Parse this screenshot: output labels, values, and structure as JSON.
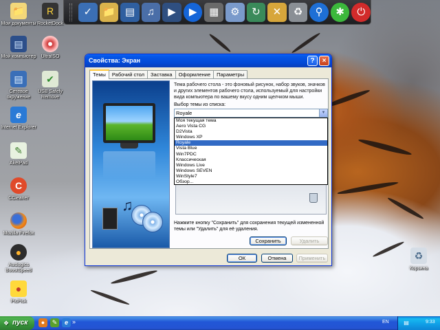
{
  "desktop": {
    "icons": [
      {
        "label": "Мои документы",
        "icon": "folder-icon"
      },
      {
        "label": "RocketDock",
        "icon": "rocket-icon"
      },
      {
        "label": "Мой компьютер",
        "icon": "computer-icon"
      },
      {
        "label": "UltraISO",
        "icon": "disc-icon"
      },
      {
        "label": "Сетевое окружение",
        "icon": "network-icon"
      },
      {
        "label": "USB Safely Remove",
        "icon": "usb-icon"
      },
      {
        "label": "Internet Explorer",
        "icon": "ie-icon"
      },
      {
        "label": "AkelPad",
        "icon": "notepad-icon"
      },
      {
        "label": "CCleaner",
        "icon": "ccleaner-icon"
      },
      {
        "label": "Mozilla Firefox",
        "icon": "firefox-icon"
      },
      {
        "label": "Auslogics BoostSpeed",
        "icon": "boostspeed-icon"
      },
      {
        "label": "PicPick",
        "icon": "picpick-icon"
      },
      {
        "label": "Корзина",
        "icon": "recycle-bin-icon"
      }
    ]
  },
  "quicklaunch": {
    "icons": [
      "monitor-check-icon",
      "folder-icon",
      "document-icon",
      "music-icon",
      "video-icon",
      "play-icon",
      "calculator-icon",
      "settings-icon",
      "network-refresh-icon",
      "close-box-icon",
      "cleanup-icon",
      "search-icon",
      "help-icon",
      "power-icon"
    ]
  },
  "dialog": {
    "title": "Свойства: Экран",
    "help_btn": "?",
    "close_btn": "×",
    "tabs": [
      "Темы",
      "Рабочий стол",
      "Заставка",
      "Оформление",
      "Параметры"
    ],
    "description": "Тема рабочего стола - это фоновый рисунок, набор звуков, значков и других элементов рабочего стола, используемый для настройки вида компьютера по вашему вкусу одним щелчком мыши.",
    "choose_label": "Выбор темы из списка:",
    "selected_theme": "Royale",
    "theme_options": [
      "Моя текущая тема",
      "Aero Vista CG",
      "D2Vista",
      "Windows XP",
      "Royale",
      "Vista Blue",
      "Win7PDC",
      "Классическая",
      "Windows Live",
      "Windows SEVEN",
      "WinStyle7",
      "Обзор..."
    ],
    "selected_index": 4,
    "save_hint": "Нажмите кнопку \"Сохранить\" для сохранения текущей измененной темы или \"Удалить\" для её удаления.",
    "save_btn": "Сохранить",
    "delete_btn": "Удалить",
    "ok_btn": "ОК",
    "cancel_btn": "Отмена",
    "apply_btn": "Применить"
  },
  "taskbar": {
    "start_label": "пуск",
    "chevron": "»",
    "language": "EN",
    "clock": "9:33"
  },
  "colors": {
    "title_bar": "#0348d4",
    "selection": "#316ac5",
    "start_button": "#37923a",
    "taskbar": "#2453d2",
    "dialog_bg": "#ece9d8"
  }
}
